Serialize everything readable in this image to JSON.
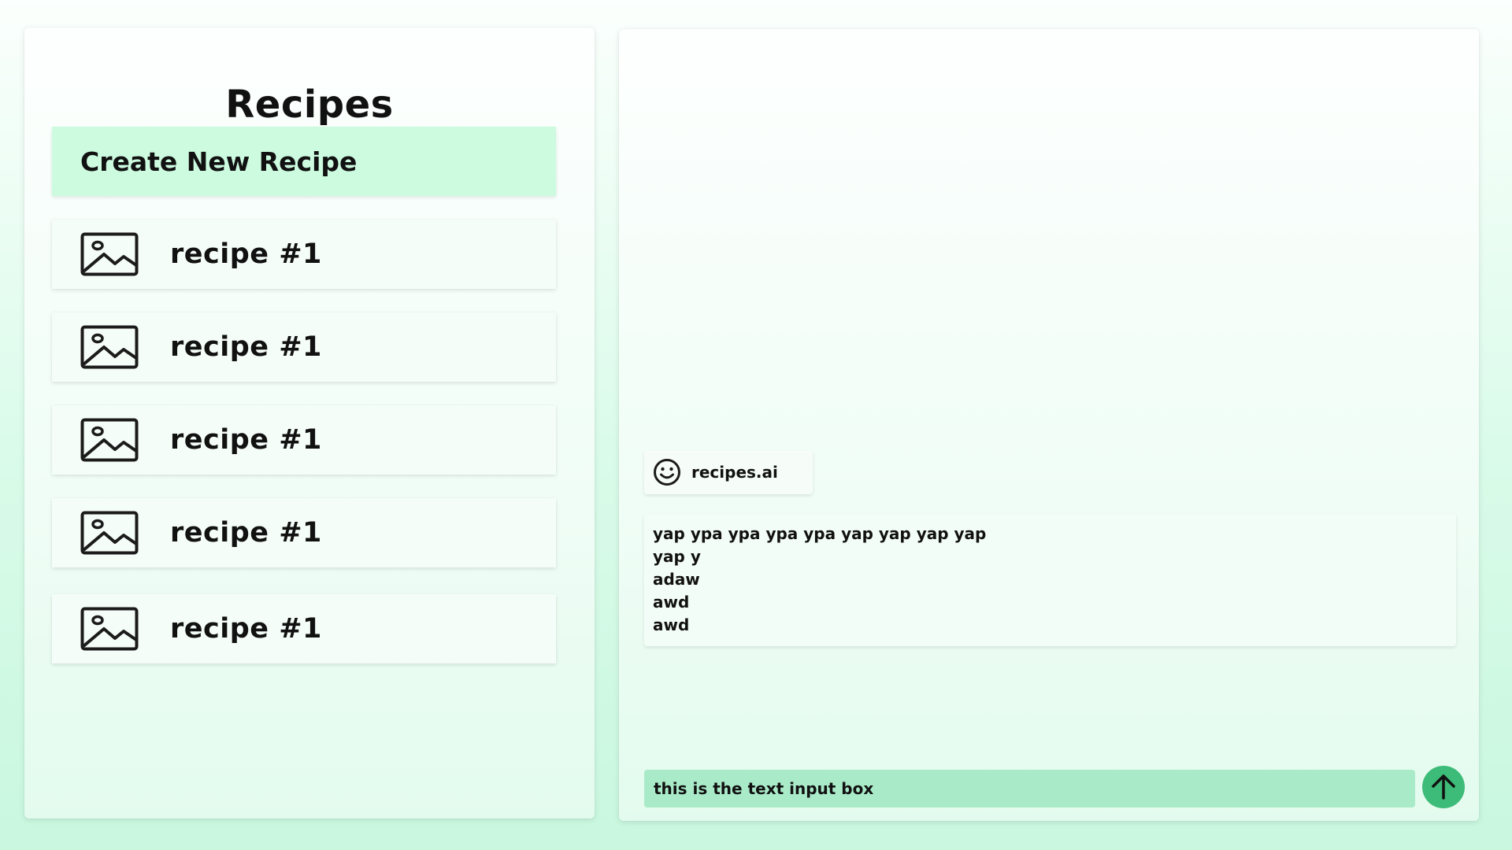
{
  "sidebar": {
    "title": "Recipes",
    "create_label": "Create New Recipe",
    "recipes": [
      {
        "label": "recipe #1",
        "icon": "image-icon"
      },
      {
        "label": "recipe #1",
        "icon": "image-icon"
      },
      {
        "label": "recipe #1",
        "icon": "image-icon"
      },
      {
        "label": "recipe #1",
        "icon": "image-icon"
      },
      {
        "label": "recipe #1",
        "icon": "image-icon"
      }
    ]
  },
  "chat": {
    "bot": {
      "name": "recipes.ai",
      "icon": "smiley-icon"
    },
    "message_lines": [
      "yap ypa ypa ypa ypa yap yap yap yap",
      "yap y",
      "adaw",
      "awd",
      "awd"
    ],
    "input_placeholder": "this is the text input box",
    "send_icon": "arrow-up-icon"
  },
  "colors": {
    "create_button": "#ccfbe0",
    "input_background": "#a9ebc9",
    "send_button": "#3dbb78"
  }
}
